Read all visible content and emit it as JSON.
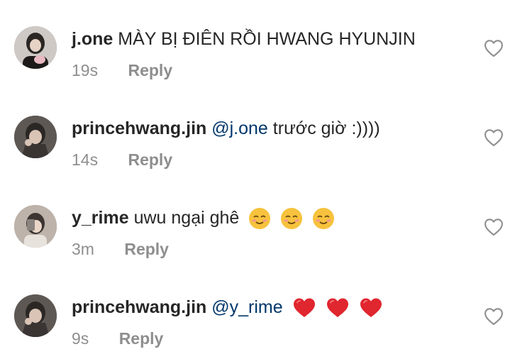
{
  "comments": [
    {
      "username": "j.one",
      "mention": "",
      "text": "MÀY BỊ ĐIÊN RỒI HWANG HYUNJIN",
      "time": "19s",
      "reply_label": "Reply",
      "avatar_icon": "profile-photo",
      "like_icon": "heart-outline-icon"
    },
    {
      "username": "princehwang.jin",
      "mention": "@j.one",
      "text": "trước giờ :))))",
      "time": "14s",
      "reply_label": "Reply",
      "avatar_icon": "profile-photo",
      "like_icon": "heart-outline-icon"
    },
    {
      "username": "y_rime",
      "mention": "",
      "text": "uwu ngại ghê",
      "emoji": [
        "smiling-face-emoji",
        "smiling-face-emoji",
        "smiling-face-emoji"
      ],
      "time": "3m",
      "reply_label": "Reply",
      "avatar_icon": "profile-photo",
      "like_icon": "heart-outline-icon"
    },
    {
      "username": "princehwang.jin",
      "mention": "@y_rime",
      "text": "",
      "emoji": [
        "red-heart-emoji",
        "red-heart-emoji",
        "red-heart-emoji"
      ],
      "time": "9s",
      "reply_label": "Reply",
      "avatar_icon": "profile-photo",
      "like_icon": "heart-outline-icon"
    }
  ],
  "colors": {
    "text": "#262626",
    "mention": "#00376b",
    "secondary": "#8e8e8e",
    "background": "#ffffff"
  }
}
